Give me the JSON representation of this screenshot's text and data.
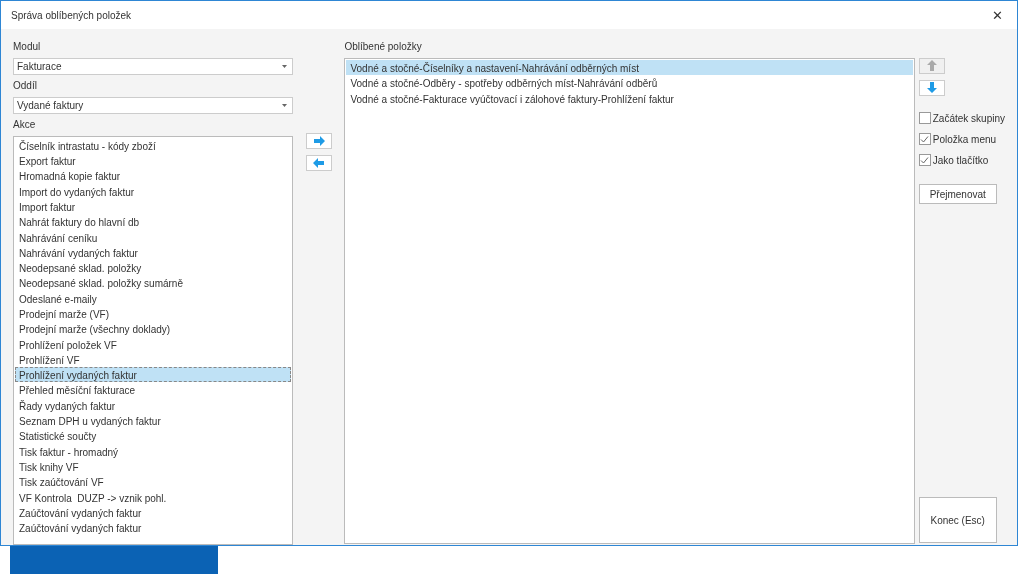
{
  "window": {
    "title": "Správa oblíbených položek",
    "close": "✕"
  },
  "modul": {
    "label": "Modul",
    "value": "Fakturace"
  },
  "oddil": {
    "label": "Oddíl",
    "value": "Vydané faktury"
  },
  "akce": {
    "label": "Akce",
    "items": [
      {
        "text": "Číselník intrastatu - kódy zboží",
        "selected": false
      },
      {
        "text": "Export faktur",
        "selected": false
      },
      {
        "text": "Hromadná kopie faktur",
        "selected": false
      },
      {
        "text": "Import do vydaných faktur",
        "selected": false
      },
      {
        "text": "Import faktur",
        "selected": false
      },
      {
        "text": "Nahrát faktury do hlavní db",
        "selected": false
      },
      {
        "text": "Nahrávání ceníku",
        "selected": false
      },
      {
        "text": "Nahrávání vydaných faktur",
        "selected": false
      },
      {
        "text": "Neodepsané sklad. položky",
        "selected": false
      },
      {
        "text": "Neodepsané sklad. položky sumárně",
        "selected": false
      },
      {
        "text": "Odeslané e-maily",
        "selected": false
      },
      {
        "text": "Prodejní marže (VF)",
        "selected": false
      },
      {
        "text": "Prodejní marže (všechny doklady)",
        "selected": false
      },
      {
        "text": "Prohlížení položek VF",
        "selected": false
      },
      {
        "text": "Prohlížení VF",
        "selected": false
      },
      {
        "text": "Prohlížení vydaných faktur",
        "selected": true
      },
      {
        "text": "Přehled měsíční fakturace",
        "selected": false
      },
      {
        "text": "Řady vydaných faktur",
        "selected": false
      },
      {
        "text": "Seznam DPH u vydaných faktur",
        "selected": false
      },
      {
        "text": "Statistické součty",
        "selected": false
      },
      {
        "text": "Tisk faktur - hromadný",
        "selected": false
      },
      {
        "text": "Tisk knihy VF",
        "selected": false
      },
      {
        "text": "Tisk zaúčtování VF",
        "selected": false
      },
      {
        "text": "VF Kontrola  DUZP -> vznik pohl.",
        "selected": false
      },
      {
        "text": "Zaúčtování vydaných faktur",
        "selected": false
      },
      {
        "text": "Zaúčtování vydaných faktur",
        "selected": false
      }
    ]
  },
  "transfer": [
    {
      "kind": "right",
      "disabled": false
    },
    {
      "kind": "left",
      "disabled": false
    }
  ],
  "oblibene": {
    "label": "Oblíbené položky",
    "items": [
      {
        "text": "Vodné a stočné-Číselníky a nastavení-Nahrávání odběrných míst",
        "selected": true
      },
      {
        "text": "Vodné a stočné-Odběry - spotřeby odběrných míst-Nahrávání odběrů",
        "selected": false
      },
      {
        "text": "Vodné a stočné-Fakturace vyúčtovací i zálohové faktury-Prohlížení faktur",
        "selected": false
      }
    ]
  },
  "order": [
    {
      "kind": "up",
      "disabled": true
    },
    {
      "kind": "down",
      "disabled": false
    }
  ],
  "options": [
    {
      "label": "Začátek skupiny",
      "checked": false
    },
    {
      "label": "Položka menu",
      "checked": true
    },
    {
      "label": "Jako tlačítko",
      "checked": true
    }
  ],
  "rename_button": "Přejmenovat",
  "close_button": "Konec (Esc)"
}
